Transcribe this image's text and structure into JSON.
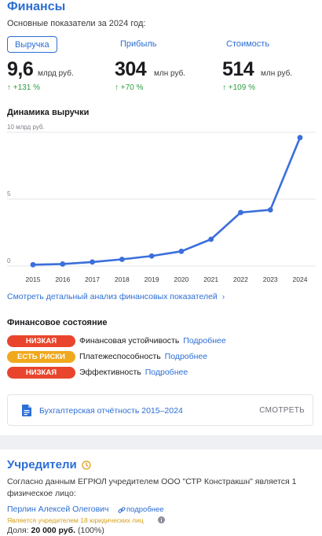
{
  "finances": {
    "title": "Финансы",
    "subtitle": "Основные показатели за 2024 год:",
    "metrics": [
      {
        "tab": "Выручка",
        "value": "9,6",
        "unit": "млрд руб.",
        "growth": "↑ +131 %",
        "active": true
      },
      {
        "tab": "Прибыль",
        "value": "304",
        "unit": "млн руб.",
        "growth": "↑ +70 %",
        "active": false
      },
      {
        "tab": "Стоимость",
        "value": "514",
        "unit": "млн руб.",
        "growth": "↑ +109 %",
        "active": false
      }
    ],
    "chart_title": "Динамика выручки",
    "analysis_link": "Смотреть детальный анализ финансовых показателей",
    "analysis_arrow": "›",
    "state_title": "Финансовое состояние",
    "states": [
      {
        "badge": "НИЗКАЯ",
        "color": "#e8452c",
        "label": "Финансовая устойчивость",
        "more": "Подробнее"
      },
      {
        "badge": "ЕСТЬ РИСКИ",
        "color": "#f0a81d",
        "label": "Платежеспособность",
        "more": "Подробнее"
      },
      {
        "badge": "НИЗКАЯ",
        "color": "#e8452c",
        "label": "Эффективность",
        "more": "Подробнее"
      }
    ],
    "report": {
      "label": "Бухгалтерская отчётность 2015–2024",
      "button": "СМОТРЕТЬ"
    }
  },
  "chart_data": {
    "type": "line",
    "title": "Динамика выручки",
    "x": [
      "2015",
      "2016",
      "2017",
      "2018",
      "2019",
      "2020",
      "2021",
      "2022",
      "2023",
      "2024"
    ],
    "values": [
      0.1,
      0.15,
      0.3,
      0.5,
      0.75,
      1.1,
      2.0,
      4.0,
      4.2,
      9.6
    ],
    "y_ticks": [
      "10 млрд руб.",
      "5",
      "0"
    ],
    "y_tick_values": [
      10,
      5,
      0
    ],
    "ylim": [
      0,
      10
    ],
    "grid": true,
    "line_color": "#3b6fdb"
  },
  "founders": {
    "title": "Учредители",
    "text": "Согласно данным ЕГРЮЛ учредителем ООО \"СТР Констракшн\" является 1 физическое лицо:",
    "person": "Перлин Алексей Олегович",
    "more": "подробнее",
    "note": "Является учредителем 18 юридических лиц",
    "share_label": "Доля:",
    "share_value": "20 000 руб.",
    "share_percent": "(100%)"
  },
  "colors": {
    "accent": "#2c6ed5",
    "positive": "#2ea043",
    "risk_low": "#e8452c",
    "risk_mid": "#f0a81d",
    "warn_text": "#d9a016"
  },
  "icons": [
    "document-icon",
    "clock-icon",
    "link-icon",
    "info-icon",
    "chevron-right-icon"
  ]
}
